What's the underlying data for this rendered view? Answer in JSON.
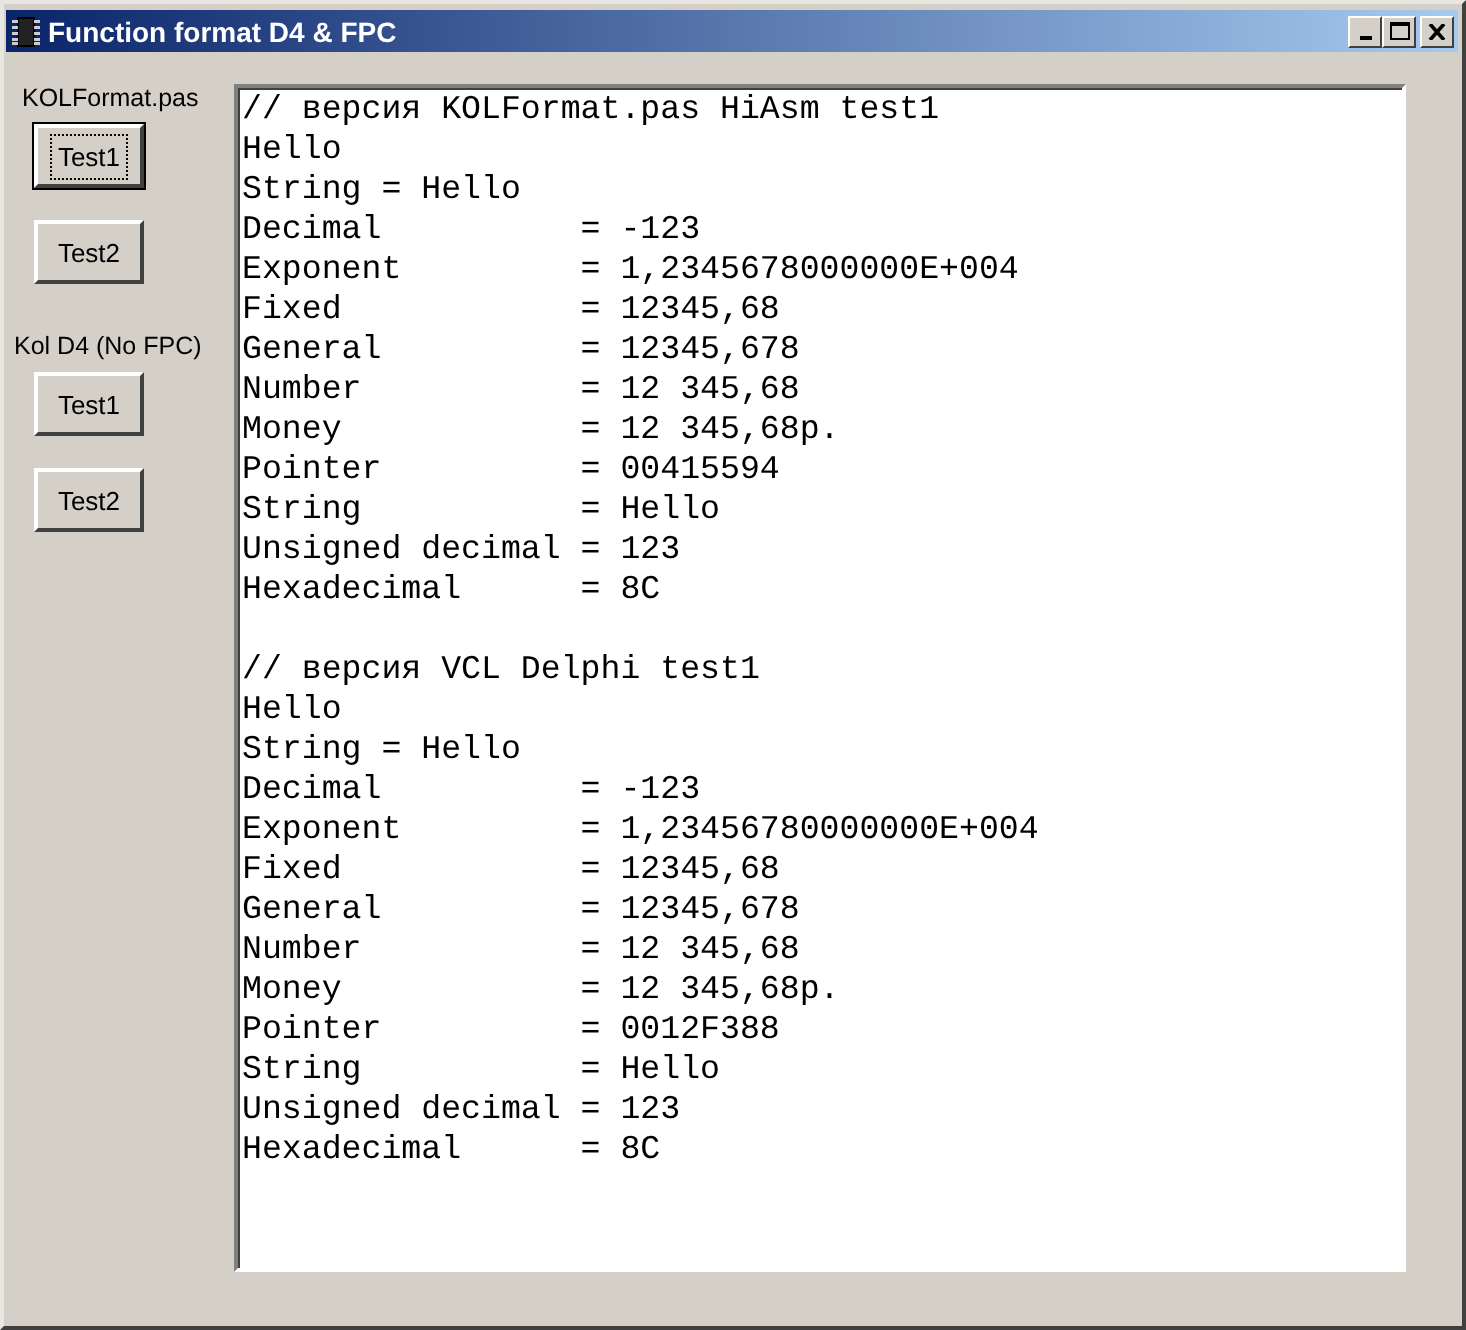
{
  "window": {
    "title": "Function format D4 & FPC"
  },
  "groups": [
    {
      "label": "KOLFormat.pas",
      "buttons": [
        {
          "label": "Test1",
          "focused": true
        },
        {
          "label": "Test2",
          "focused": false
        }
      ]
    },
    {
      "label": "Kol D4 (No FPC)",
      "buttons": [
        {
          "label": "Test1",
          "focused": false
        },
        {
          "label": "Test2",
          "focused": false
        }
      ]
    }
  ],
  "memo": {
    "blocks": [
      [
        "// версия KOLFormat.pas HiAsm test1",
        "Hello",
        "String = Hello",
        "Decimal          = -123",
        "Exponent         = 1,2345678000000E+004",
        "Fixed            = 12345,68",
        "General          = 12345,678",
        "Number           = 12 345,68",
        "Money            = 12 345,68р.",
        "Pointer          = 00415594",
        "String           = Hello",
        "Unsigned decimal = 123",
        "Hexadecimal      = 8C"
      ],
      [
        "// версия VCL Delphi test1",
        "Hello",
        "String = Hello",
        "Decimal          = -123",
        "Exponent         = 1,23456780000000E+004",
        "Fixed            = 12345,68",
        "General          = 12345,678",
        "Number           = 12 345,68",
        "Money            = 12 345,68р.",
        "Pointer          = 0012F388",
        "String           = Hello",
        "Unsigned decimal = 123",
        "Hexadecimal      = 8C"
      ]
    ]
  }
}
